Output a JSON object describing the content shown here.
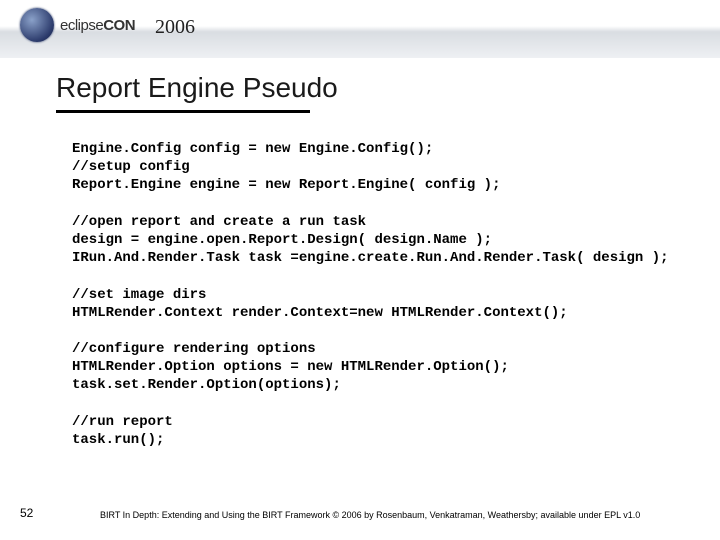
{
  "header": {
    "brand_prefix": "eclipse",
    "brand_suffix": "CON",
    "year": "2006"
  },
  "title": "Report Engine Pseudo",
  "code": "Engine.Config config = new Engine.Config();\n//setup config\nReport.Engine engine = new Report.Engine( config );\n\n//open report and create a run task\ndesign = engine.open.Report.Design( design.Name );\nIRun.And.Render.Task task =engine.create.Run.And.Render.Task( design );\n\n//set image dirs\nHTMLRender.Context render.Context=new HTMLRender.Context();\n\n//configure rendering options\nHTMLRender.Option options = new HTMLRender.Option();\ntask.set.Render.Option(options);\n\n//run report\ntask.run(); ",
  "page_number": "52",
  "footer": "BIRT In Depth: Extending and Using the BIRT Framework © 2006 by Rosenbaum, Venkatraman, Weathersby; available under EPL v1.0"
}
